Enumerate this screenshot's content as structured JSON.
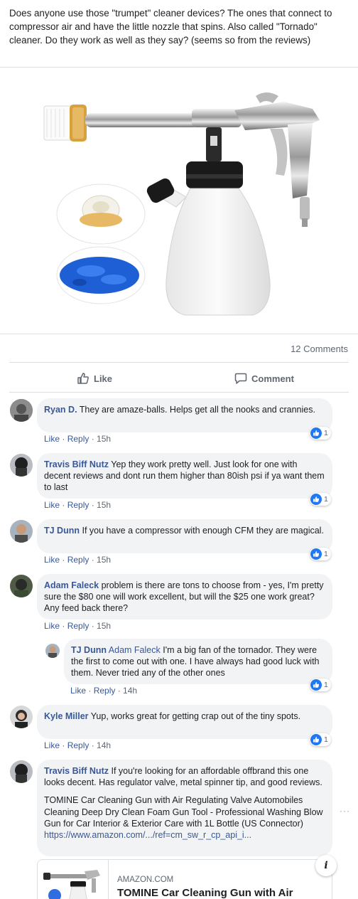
{
  "post": {
    "text": "Does anyone use those \"trumpet\" cleaner devices? The ones that connect to compressor air and have the little nozzle that spins. Also called \"Tornado\" cleaner. Do they work as well as they say? (seems so from the reviews)",
    "comment_count": "12 Comments",
    "like_label": "Like",
    "comment_label": "Comment"
  },
  "comments": [
    {
      "author": "Ryan D.",
      "text": "They are amaze-balls. Helps get all the nooks and crannies.",
      "like": "Like",
      "reply": "Reply",
      "time": "15h",
      "reactions": "1"
    },
    {
      "author": "Travis Biff Nutz",
      "text": "Yep they work pretty well. Just look for one with decent reviews and dont run them higher than 80ish psi if ya want them to last",
      "like": "Like",
      "reply": "Reply",
      "time": "15h",
      "reactions": "1"
    },
    {
      "author": "TJ Dunn",
      "text": "If you have a compressor with enough CFM they are magical.",
      "like": "Like",
      "reply": "Reply",
      "time": "15h",
      "reactions": "1"
    },
    {
      "author": "Adam Faleck",
      "text": "problem is there are tons to choose from - yes, I'm pretty sure the $80 one will work excellent, but will the $25 one work great? Any feed back there?",
      "like": "Like",
      "reply": "Reply",
      "time": "15h"
    },
    {
      "author": "TJ Dunn",
      "mention": "Adam Faleck",
      "text": "I'm a big fan of the tornador. They were the first to come out with one. I have always had good luck with them. Never tried any of the other ones",
      "like": "Like",
      "reply": "Reply",
      "time": "14h",
      "reactions": "1"
    },
    {
      "author": "Kyle Miller",
      "text": "Yup, works great for getting crap out of the tiny spots.",
      "like": "Like",
      "reply": "Reply",
      "time": "14h",
      "reactions": "1"
    },
    {
      "author": "Travis Biff Nutz",
      "text": "If you're looking for an affordable offbrand this one looks decent. Has regulator valve, metal spinner tip, and good reviews.",
      "text2": "TOMINE Car Cleaning Gun with Air Regulating Valve Automobiles Cleaning Deep Dry Clean Foam Gun Tool - Professional Washing Blow Gun for Car Interior & Exterior Care with 1L Bottle (US Connector)",
      "link": "https://www.amazon.com/.../ref=cm_sw_r_cp_api_i..."
    }
  ],
  "share_card": {
    "domain": "AMAZON.COM",
    "title": "TOMINE Car Cleaning Gun with Air"
  },
  "colors": {
    "link": "#385898",
    "bubble": "#f2f3f5",
    "reaction": "#2078f4"
  }
}
